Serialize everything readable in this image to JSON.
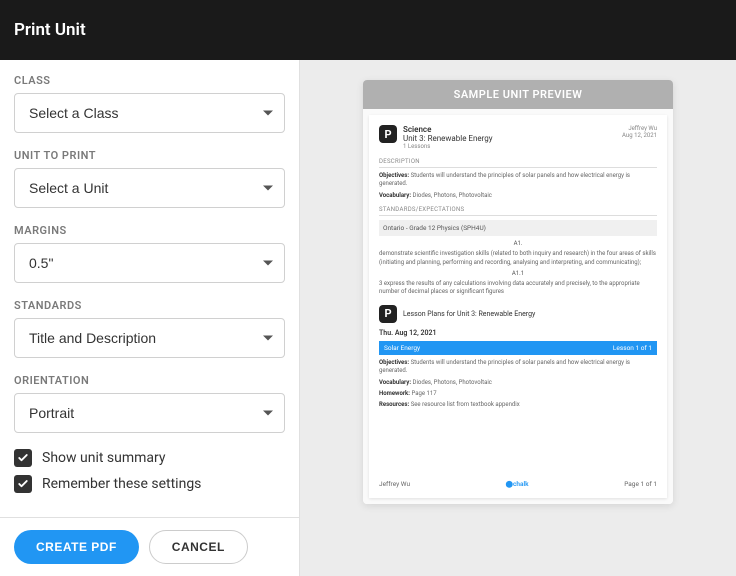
{
  "header": {
    "title": "Print Unit"
  },
  "form": {
    "class": {
      "label": "CLASS",
      "value": "Select a Class"
    },
    "unit": {
      "label": "UNIT TO PRINT",
      "value": "Select a Unit"
    },
    "margins": {
      "label": "MARGINS",
      "value": "0.5\""
    },
    "standards": {
      "label": "STANDARDS",
      "value": "Title and Description"
    },
    "orientation": {
      "label": "ORIENTATION",
      "value": "Portrait"
    },
    "show_summary": {
      "label": "Show unit summary",
      "checked": true
    },
    "remember": {
      "label": "Remember these settings",
      "checked": true
    }
  },
  "footer": {
    "create": "CREATE PDF",
    "cancel": "CANCEL"
  },
  "preview": {
    "header": "SAMPLE UNIT PREVIEW",
    "subject": "Science",
    "unit_title": "Unit 3: Renewable Energy",
    "lesson_count": "1 Lessons",
    "author": "Jeffrey Wu",
    "date": "Aug 12, 2021",
    "desc_label": "DESCRIPTION",
    "objectives": "Objectives: Students will understand the principles of solar panels and how electrical energy is generated.",
    "vocabulary": "Vocabulary: Diodes, Photons, Photovoltaic",
    "standards_label": "STANDARDS/EXPECTATIONS",
    "course": "Ontario - Grade 12 Physics (SPH4U)",
    "a1_label": "A1.",
    "a1_text": "demonstrate scientific investigation skills (related to both inquiry and research) in the four areas of skills (initiating and planning, performing and recording, analysing and interpreting, and communicating);",
    "a11_label": "A1.1",
    "a11_text": "3 express the results of any calculations involving data accurately and precisely, to the appropriate number of decimal places or significant figures",
    "plans_title": "Lesson Plans for Unit 3: Renewable Energy",
    "plan_date": "Thu. Aug 12, 2021",
    "lesson_name": "Solar Energy",
    "lesson_badge": "Lesson 1 of 1",
    "plan_objectives": "Objectives: Students will understand the principles of solar panels and how electrical energy is generated.",
    "plan_vocab": "Vocabulary: Diodes, Photons, Photovoltaic",
    "homework": "Homework: Page 117",
    "resources": "Resources: See resource list from textbook appendix",
    "brand": "chalk",
    "page_num": "Page 1 of 1"
  }
}
